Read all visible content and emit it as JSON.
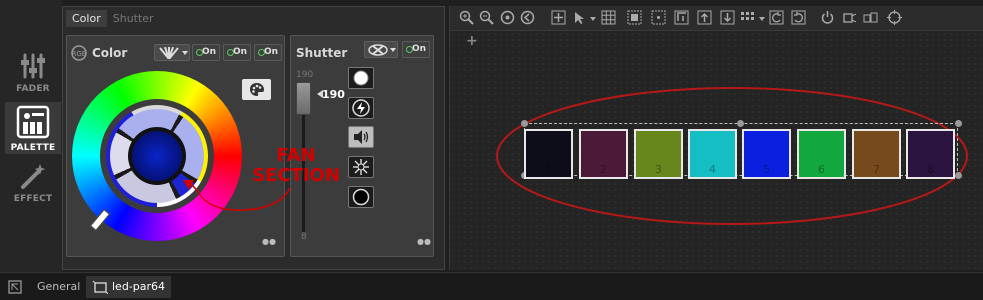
{
  "sidebar": {
    "items": [
      {
        "label": "FADER",
        "icon": "sliders-icon"
      },
      {
        "label": "PALETTE",
        "icon": "palette-icon"
      },
      {
        "label": "EFFECT",
        "icon": "magic-wand-icon"
      }
    ],
    "active": "PALETTE"
  },
  "tabs": [
    {
      "label": "Color",
      "active": true
    },
    {
      "label": "Shutter",
      "active": false
    }
  ],
  "color_card": {
    "title": "Color",
    "on_buttons": [
      "On",
      "On",
      "On"
    ]
  },
  "shutter_card": {
    "title": "Shutter",
    "on_button": "On",
    "slider_max": "190",
    "slider_value": "190",
    "slider_min": "8"
  },
  "annotation": {
    "text_line1": "FAN",
    "text_line2": "SECTION",
    "color": "#d40000"
  },
  "palette_swatches": [
    {
      "number": "1",
      "color": "#0c0d18"
    },
    {
      "number": "2",
      "color": "#4c1a38"
    },
    {
      "number": "3",
      "color": "#67861c"
    },
    {
      "number": "4",
      "color": "#14bec3"
    },
    {
      "number": "5",
      "color": "#0a1fdf"
    },
    {
      "number": "6",
      "color": "#13a83d"
    },
    {
      "number": "7",
      "color": "#764a1c"
    },
    {
      "number": "8",
      "color": "#2b1440"
    }
  ],
  "canvas": {
    "add_label": "+"
  },
  "bottom_tabs": [
    {
      "label": "General",
      "active": false
    },
    {
      "label": "led-par64",
      "active": true
    }
  ],
  "toolbar_icons": [
    "zoom-in-icon",
    "zoom-out-icon",
    "zoom-reset-icon",
    "back-icon",
    "move-icon",
    "select-arrow-icon",
    "grid-icon",
    "select-all-icon",
    "select-none-icon",
    "align-top-icon",
    "align-up-icon",
    "align-down-icon",
    "distribute-icon",
    "undo-icon",
    "redo-icon",
    "power-icon",
    "fixture-icon",
    "fixture-group-icon",
    "target-icon"
  ]
}
